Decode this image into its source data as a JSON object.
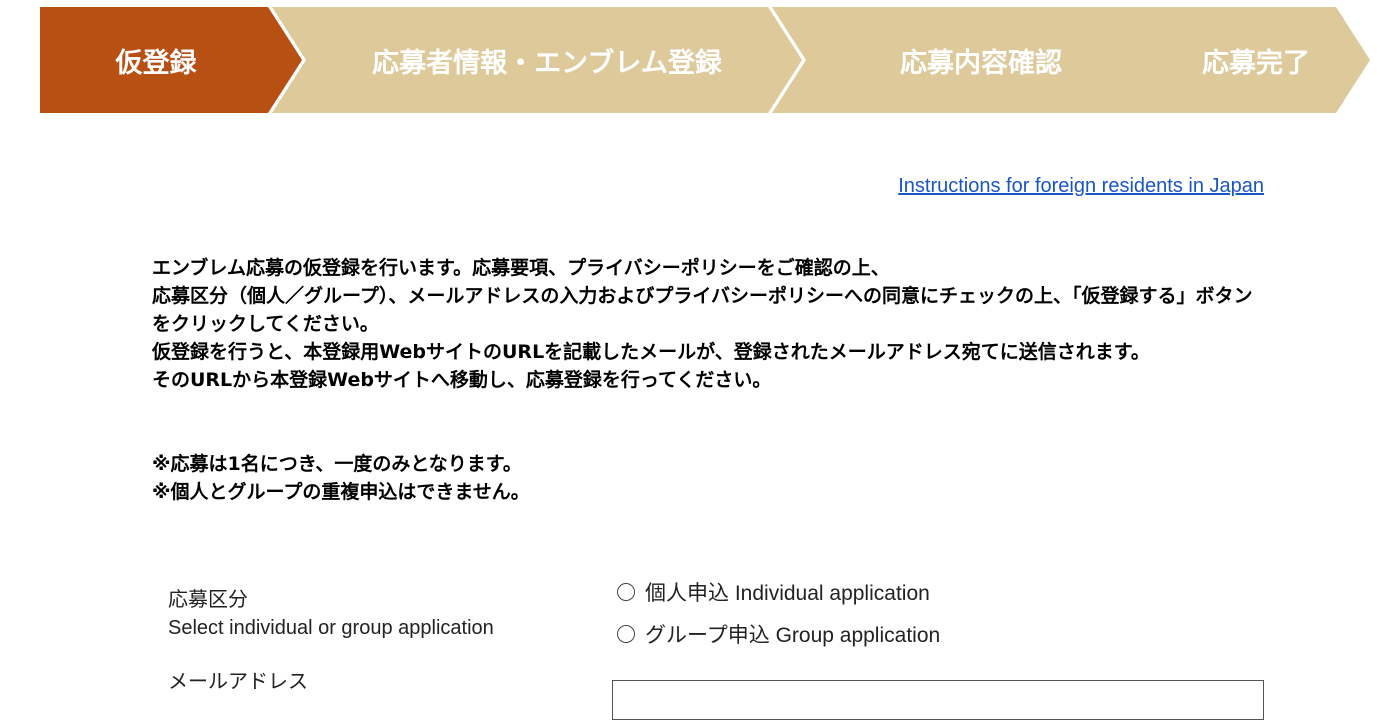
{
  "steps": [
    {
      "label": "仮登録",
      "state": "active"
    },
    {
      "label": "応募者情報・エンブレム登録",
      "state": "inactive"
    },
    {
      "label": "応募内容確認",
      "state": "inactive"
    },
    {
      "label": "応募完了",
      "state": "inactive"
    }
  ],
  "colors": {
    "active_step": "#b84f13",
    "inactive_step": "#ddc99a",
    "link": "#1a55c4"
  },
  "foreign_link": "Instructions for foreign residents in Japan",
  "intro_lines": [
    "エンブレム応募の仮登録を行います。応募要項、プライバシーポリシーをご確認の上、",
    "応募区分（個人／グループ）、メールアドレスの入力およびプライバシーポリシーへの同意にチェックの上、「仮登録する」ボタンをクリックしてください。",
    "仮登録を行うと、本登録用WebサイトのURLを記載したメールが、登録されたメールアドレス宛てに送信されます。",
    "そのURLから本登録Webサイトへ移動し、応募登録を行ってください。"
  ],
  "notes": [
    "※応募は1名につき、一度のみとなります。",
    "※個人とグループの重複申込はできません。"
  ],
  "form": {
    "application_type": {
      "label_ja": "応募区分",
      "label_en": "Select individual or group application",
      "options": [
        {
          "label": "個人申込 Individual application",
          "selected": false
        },
        {
          "label": "グループ申込 Group application",
          "selected": false
        }
      ]
    },
    "email": {
      "label_ja": "メールアドレス",
      "value": ""
    }
  }
}
